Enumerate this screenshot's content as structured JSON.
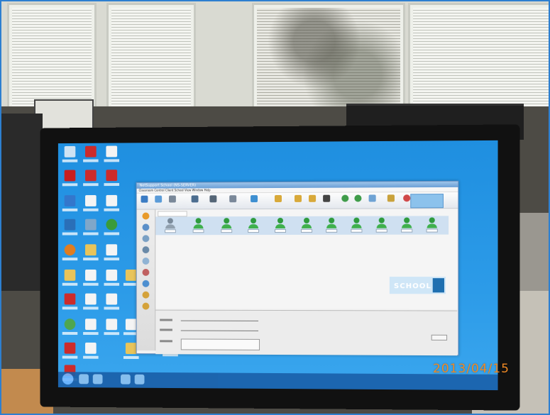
{
  "photo": {
    "date_stamp": "2013/04/15"
  },
  "app_window": {
    "title": "NetSupport School (NS-SERVER)",
    "menu": "Classroom  Control  Client  School  View  Window  Help",
    "logo_text": "SCHOOL"
  }
}
